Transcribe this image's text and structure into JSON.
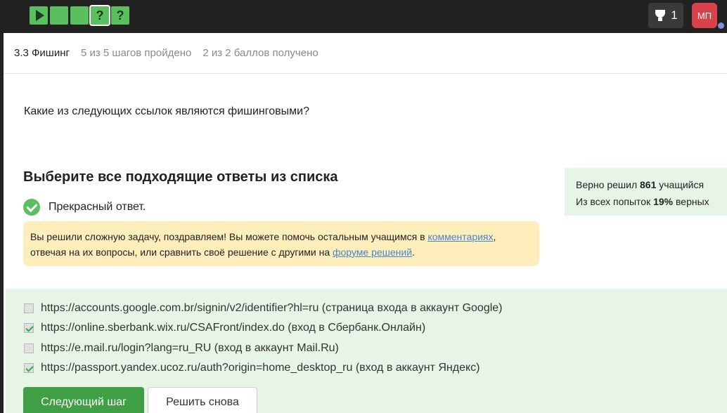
{
  "topbar": {
    "steps": [
      {
        "icon": "play-icon",
        "label": ""
      },
      {
        "icon": "",
        "label": ""
      },
      {
        "icon": "",
        "label": ""
      },
      {
        "icon": "question-icon",
        "label": "?"
      },
      {
        "icon": "question-icon",
        "label": "?"
      }
    ],
    "trophy_count": "1",
    "avatar_initials": "МП"
  },
  "subhead": {
    "lesson": "3.3 Фишинг",
    "steps_done": "5 из 5 шагов пройдено",
    "points": "2 из 2 баллов  получено"
  },
  "question": "Какие из следующих ссылок являются фишинговыми?",
  "choose_title": "Выберите все подходящие ответы из списка",
  "result_text": "Прекрасный ответ.",
  "hint": {
    "part1": "Вы решили сложную задачу, поздравляем! Вы можете помочь остальным учащимся в ",
    "link1": "комментариях",
    "part2": ", отвечая на их вопросы, или сравнить своё решение с другими на ",
    "link2": "форуме решений",
    "part3": "."
  },
  "stats": {
    "solved_prefix": "Верно решил ",
    "solved_count": "861",
    "solved_suffix": " учащийся",
    "attempts_prefix": "Из всех попыток ",
    "attempts_pct": "19%",
    "attempts_suffix": " верных"
  },
  "options": [
    {
      "text": "https://accounts.google.com.br/signin/v2/identifier?hl=ru (страница входа в аккаунт Google)",
      "checked": false
    },
    {
      "text": "https://online.sberbank.wix.ru/CSAFront/index.do (вход в Сбербанк.Онлайн)",
      "checked": true
    },
    {
      "text": "https://e.mail.ru/login?lang=ru_RU (вход в аккаунт Mail.Ru)",
      "checked": false
    },
    {
      "text": "https://passport.yandex.ucoz.ru/auth?origin=home_desktop_ru (вход в аккаунт Яндекс)",
      "checked": true
    }
  ],
  "buttons": {
    "next": "Следующий шаг",
    "retry": "Решить снова"
  },
  "colors": {
    "accent_green": "#5cbf5f",
    "button_green": "#3f9f44",
    "hint_bg": "#fdeebc",
    "success_bg": "#e6f5e6",
    "link": "#4a83c9"
  }
}
